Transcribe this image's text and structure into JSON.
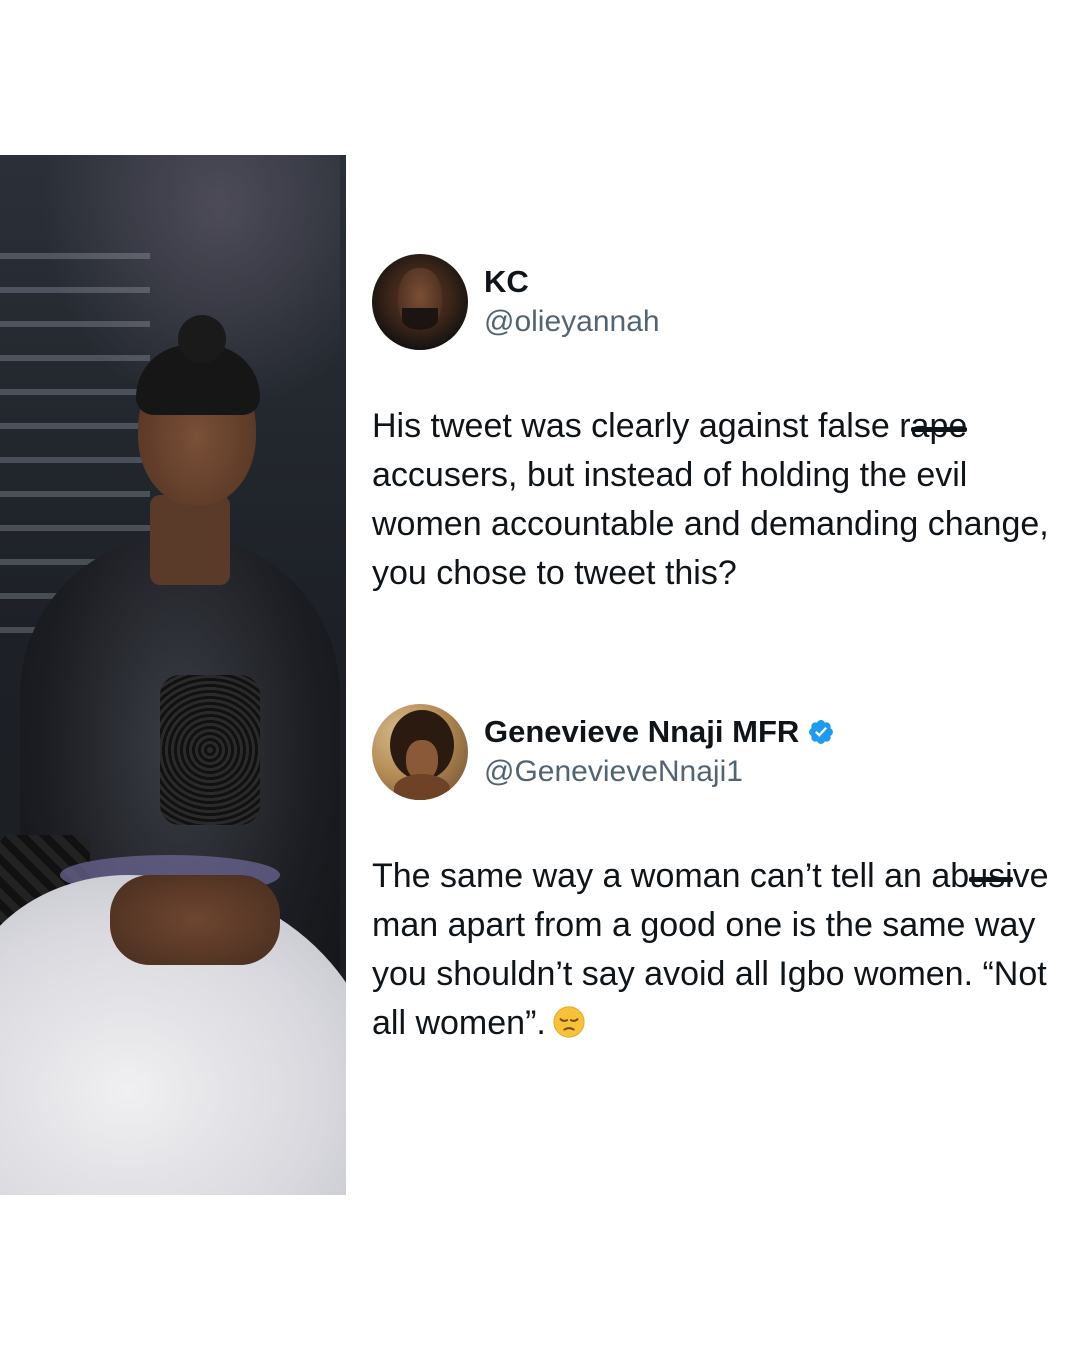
{
  "tweets": [
    {
      "name": "KC",
      "handle": "@olieyannah",
      "verified": false,
      "text_before": "His tweet was clearly against false r",
      "text_struck": "ape",
      "text_after": " accusers, but instead of holding the evil women accountable and demanding change, you chose to tweet this?"
    },
    {
      "name": "Genevieve Nnaji MFR",
      "handle": "@GenevieveNnaji1",
      "verified": true,
      "text_before": "The same way  a woman can’t tell an ab",
      "text_struck": "usi",
      "text_after": "ve man apart from a good one is the same way you shouldn’t say avoid all Igbo women. “Not all women”.",
      "emoji": "pensive-face"
    }
  ],
  "colors": {
    "verified": "#1d9bf0",
    "text": "#0f1419",
    "handle": "#536471",
    "emoji": "#f7c23a"
  },
  "icons": {
    "verified": "verified-badge-icon",
    "emoji": "pensive-face-emoji-icon"
  }
}
